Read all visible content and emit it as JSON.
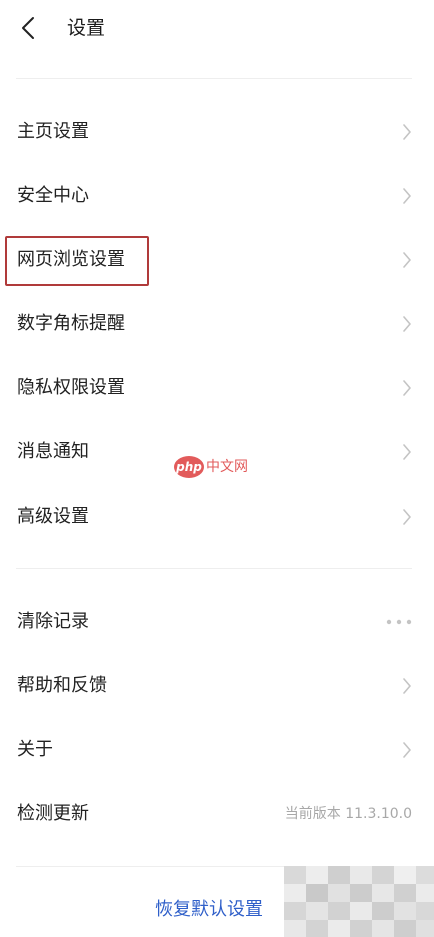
{
  "header": {
    "title": "设置"
  },
  "section1": {
    "items": [
      {
        "label": "主页设置"
      },
      {
        "label": "安全中心"
      },
      {
        "label": "网页浏览设置"
      },
      {
        "label": "数字角标提醒"
      },
      {
        "label": "隐私权限设置"
      },
      {
        "label": "消息通知"
      },
      {
        "label": "高级设置"
      }
    ]
  },
  "section2": {
    "clear_records": {
      "label": "清除记录"
    },
    "help": {
      "label": "帮助和反馈"
    },
    "about": {
      "label": "关于"
    },
    "check_update": {
      "label": "检测更新",
      "value": "当前版本 11.3.10.0"
    }
  },
  "footer": {
    "reset_label": "恢复默认设置"
  },
  "watermark": {
    "logo": "php",
    "text": "中文网"
  },
  "colors": {
    "highlight": "#b03a3a",
    "link": "#2f5fc9",
    "watermark": "#e25b5b"
  },
  "icons": {
    "back": "back-arrow-icon",
    "row": "chevron-right-icon",
    "more": "more-dots-icon"
  }
}
